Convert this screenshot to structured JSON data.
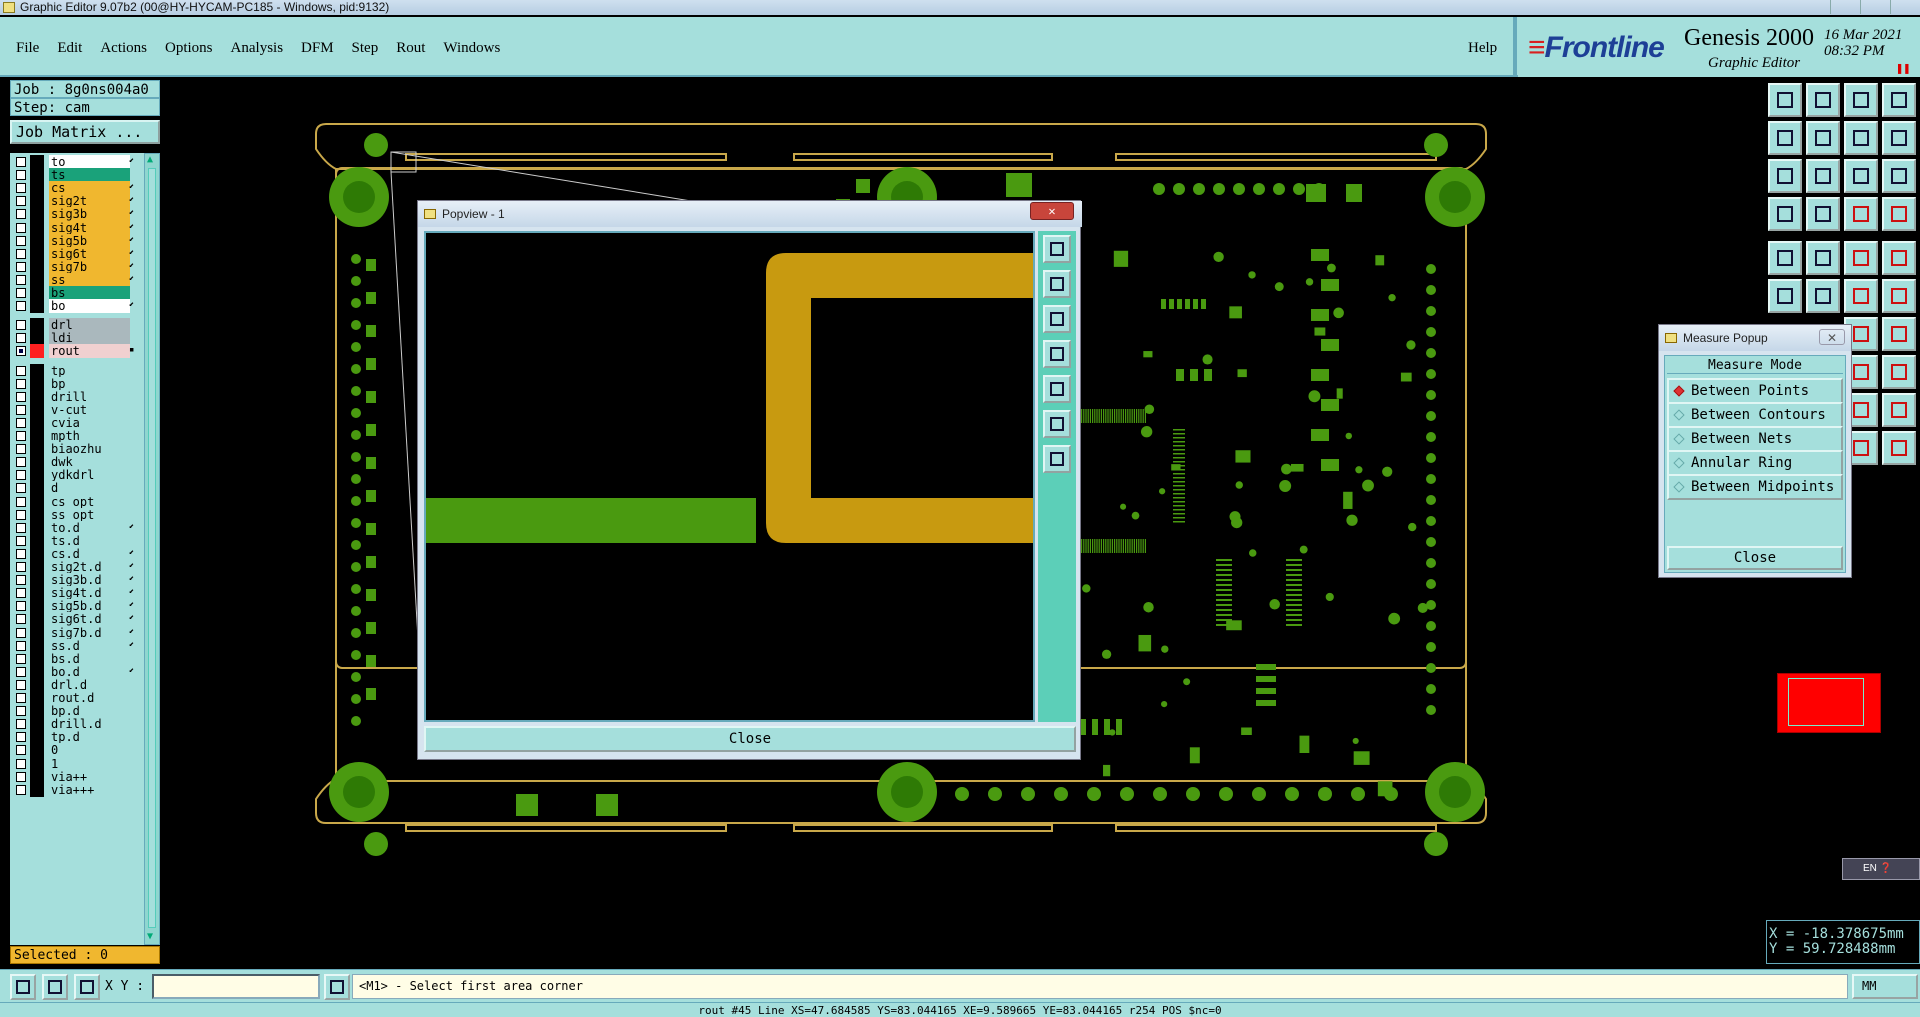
{
  "window": {
    "title": "Graphic Editor 9.07b2 (00@HY-HYCAM-PC185 - Windows, pid:9132)"
  },
  "menu": {
    "items": [
      "File",
      "Edit",
      "Actions",
      "Options",
      "Analysis",
      "DFM",
      "Step",
      "Rout",
      "Windows"
    ],
    "help": "Help"
  },
  "brand": {
    "logo": "Frontline",
    "product": "Genesis 2000",
    "subtitle": "Graphic Editor",
    "date": "16 Mar 2021",
    "time": "08:32 PM"
  },
  "job": {
    "job_label": "Job : 8g0ns004a0",
    "step_label": "Step: cam",
    "matrix_button": "Job Matrix ..."
  },
  "layers": [
    {
      "name": "to",
      "color": "white",
      "flag": "⬋"
    },
    {
      "name": "ts",
      "color": "green",
      "flag": ""
    },
    {
      "name": "cs",
      "color": "orange",
      "flag": "⬋"
    },
    {
      "name": "sig2t",
      "color": "orange",
      "flag": "⬋"
    },
    {
      "name": "sig3b",
      "color": "orange",
      "flag": "⬋"
    },
    {
      "name": "sig4t",
      "color": "orange",
      "flag": "⬋"
    },
    {
      "name": "sig5b",
      "color": "orange",
      "flag": "⬋"
    },
    {
      "name": "sig6t",
      "color": "orange",
      "flag": "⬋"
    },
    {
      "name": "sig7b",
      "color": "orange",
      "flag": "⬋"
    },
    {
      "name": "ss",
      "color": "orange",
      "flag": "⬋"
    },
    {
      "name": "bs",
      "color": "green",
      "flag": ""
    },
    {
      "name": "bo",
      "color": "white",
      "flag": "⬋"
    },
    {
      "name": "drl",
      "color": "grey",
      "flag": "",
      "gap": true
    },
    {
      "name": "ldi",
      "color": "grey",
      "flag": ""
    },
    {
      "name": "rout",
      "color": "pink",
      "flag": "▪",
      "active": true
    },
    {
      "name": "tp",
      "color": "plain",
      "flag": "",
      "gap": true
    },
    {
      "name": "bp",
      "color": "plain",
      "flag": ""
    },
    {
      "name": "drill",
      "color": "plain",
      "flag": ""
    },
    {
      "name": "v-cut",
      "color": "plain",
      "flag": ""
    },
    {
      "name": "cvia",
      "color": "plain",
      "flag": ""
    },
    {
      "name": "mpth",
      "color": "plain",
      "flag": ""
    },
    {
      "name": "biaozhu",
      "color": "plain",
      "flag": ""
    },
    {
      "name": "dwk",
      "color": "plain",
      "flag": ""
    },
    {
      "name": "ydkdrl",
      "color": "plain",
      "flag": ""
    },
    {
      "name": "d",
      "color": "plain",
      "flag": ""
    },
    {
      "name": "cs_opt",
      "color": "plain",
      "flag": ""
    },
    {
      "name": "ss_opt",
      "color": "plain",
      "flag": ""
    },
    {
      "name": "to.d",
      "color": "plain",
      "flag": "⬋"
    },
    {
      "name": "ts.d",
      "color": "plain",
      "flag": ""
    },
    {
      "name": "cs.d",
      "color": "plain",
      "flag": "⬋"
    },
    {
      "name": "sig2t.d",
      "color": "plain",
      "flag": "⬋"
    },
    {
      "name": "sig3b.d",
      "color": "plain",
      "flag": "⬋"
    },
    {
      "name": "sig4t.d",
      "color": "plain",
      "flag": "⬋"
    },
    {
      "name": "sig5b.d",
      "color": "plain",
      "flag": "⬋"
    },
    {
      "name": "sig6t.d",
      "color": "plain",
      "flag": "⬋"
    },
    {
      "name": "sig7b.d",
      "color": "plain",
      "flag": "⬋"
    },
    {
      "name": "ss.d",
      "color": "plain",
      "flag": "⬋"
    },
    {
      "name": "bs.d",
      "color": "plain",
      "flag": ""
    },
    {
      "name": "bo.d",
      "color": "plain",
      "flag": "⬋"
    },
    {
      "name": "drl.d",
      "color": "plain",
      "flag": ""
    },
    {
      "name": "rout.d",
      "color": "plain",
      "flag": ""
    },
    {
      "name": "bp.d",
      "color": "plain",
      "flag": ""
    },
    {
      "name": "drill.d",
      "color": "plain",
      "flag": ""
    },
    {
      "name": "tp.d",
      "color": "plain",
      "flag": ""
    },
    {
      "name": "0",
      "color": "plain",
      "flag": ""
    },
    {
      "name": "1",
      "color": "plain",
      "flag": ""
    },
    {
      "name": "via++",
      "color": "plain",
      "flag": ""
    },
    {
      "name": "via+++",
      "color": "plain",
      "flag": ""
    }
  ],
  "selected_label": "Selected : 0",
  "popview": {
    "title": "Popview - 1",
    "close_label": "Close"
  },
  "measure": {
    "title": "Measure Popup",
    "mode_label": "Measure Mode",
    "options": [
      "Between Points",
      "Between Contours",
      "Between Nets",
      "Annular Ring",
      "Between Midpoints"
    ],
    "selected_option": "Between Points",
    "close_label": "Close"
  },
  "coords": {
    "x": "X = -18.378675mm",
    "y": "Y = 59.728488mm"
  },
  "ime": {
    "label": "EN"
  },
  "bottom": {
    "xy_label": "X Y :",
    "xy_value": "",
    "message": "<M1> - Select first area corner",
    "units": "MM"
  },
  "status_line": "rout #45 Line XS=47.684585 YS=83.044165 XE=9.589665 YE=83.044165 r254 POS $nc=0",
  "colors": {
    "panel": "#a5dfdc",
    "copper": "#4a9a10",
    "outline": "#c9a84a",
    "highlight": "#c89a10"
  }
}
